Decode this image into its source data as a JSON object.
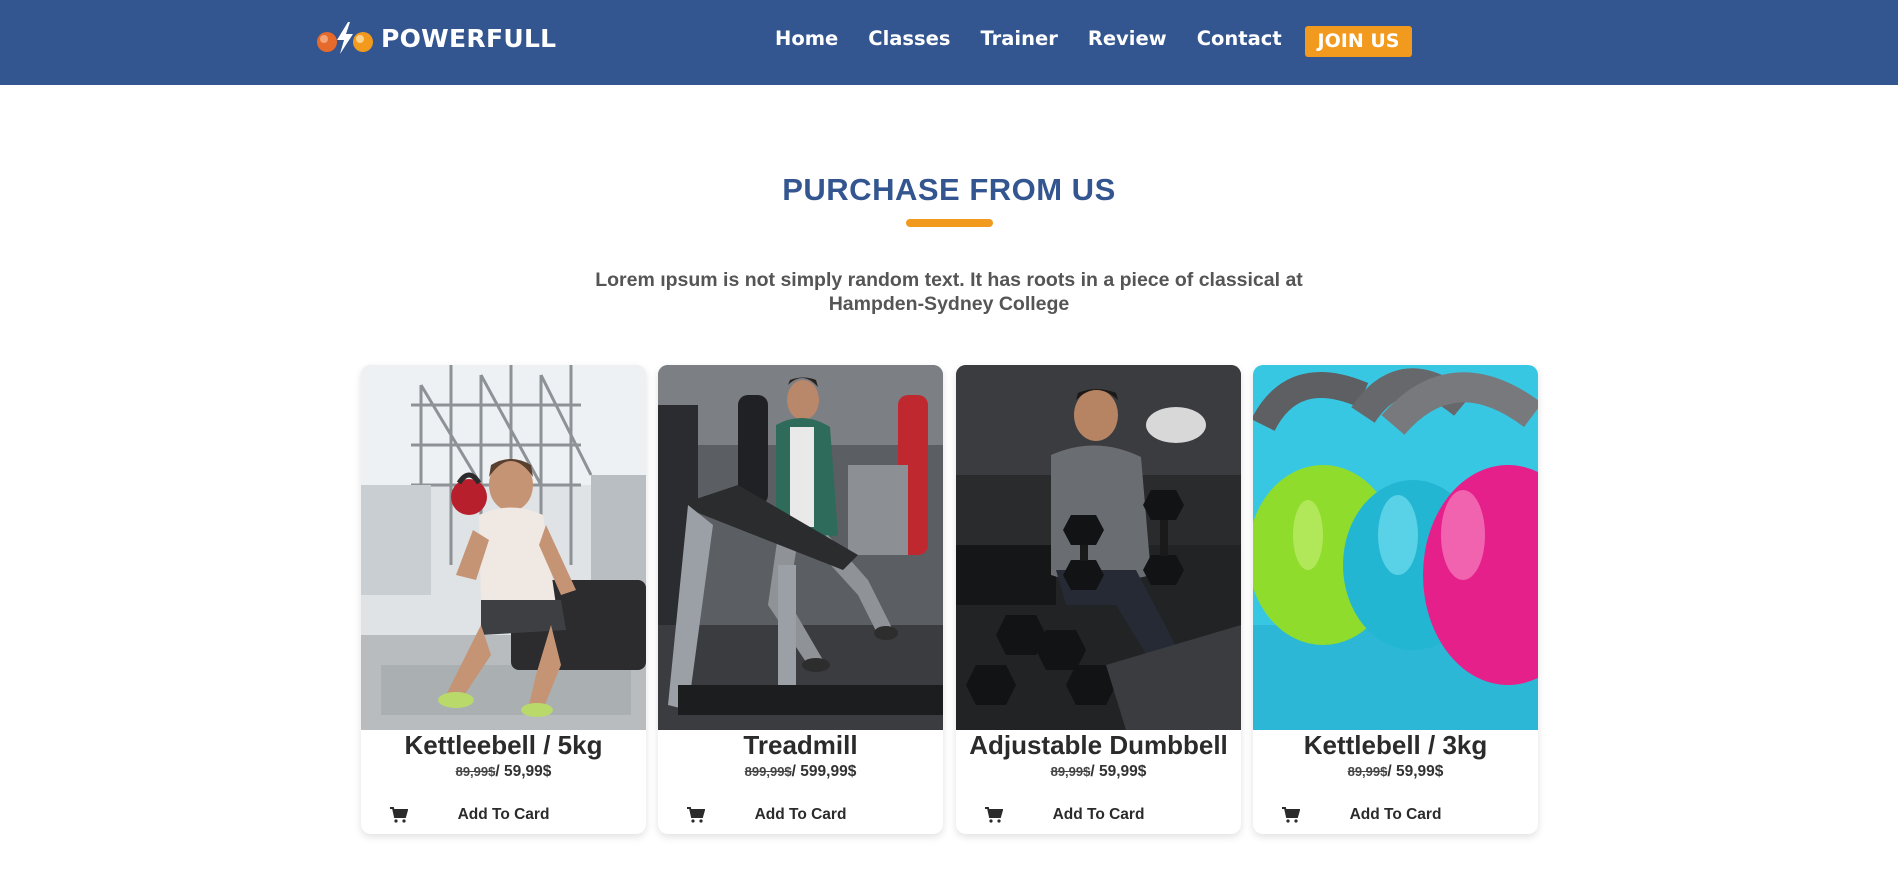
{
  "brand": {
    "name": "POWERFULL"
  },
  "nav": {
    "links": [
      "Home",
      "Classes",
      "Trainer",
      "Review",
      "Contact"
    ],
    "cta": "JOIN US"
  },
  "section": {
    "title": "PURCHASE FROM US",
    "description": "Lorem ıpsum is not simply random text. It has roots in a piece of classical at Hampden-Sydney College"
  },
  "products": [
    {
      "name": "Kettleebell / 5kg",
      "old_price": "89,99$",
      "price": "59,99$",
      "button": "Add To Card"
    },
    {
      "name": "Treadmill",
      "old_price": "899,99$",
      "price": "599,99$",
      "button": "Add To Card"
    },
    {
      "name": "Adjustable Dumbbell",
      "old_price": "89,99$",
      "price": "59,99$",
      "button": "Add To Card"
    },
    {
      "name": "Kettlebell / 3kg",
      "old_price": "89,99$",
      "price": "59,99$",
      "button": "Add To Card"
    }
  ],
  "colors": {
    "navbar": "#345690",
    "accent": "#f29a1e",
    "title": "#345690"
  }
}
